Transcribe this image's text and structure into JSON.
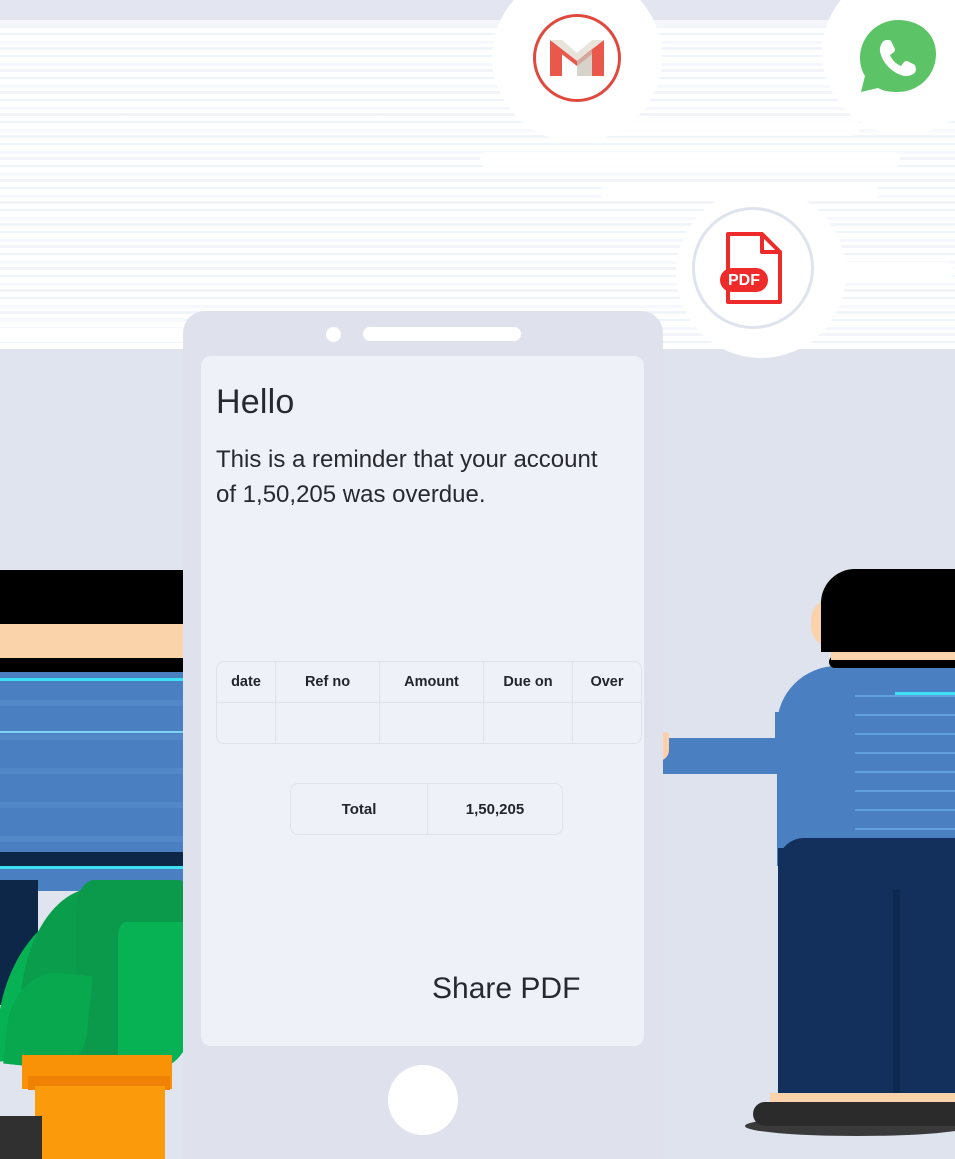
{
  "scene": {
    "title": "Overdue payment reminder on tablet",
    "colors": {
      "background": "#ffffff",
      "wall": "#e0e4ef",
      "panel": "#dfe3ee",
      "tablet_bezel": "#dfe2ec",
      "screen": "#eef1f7",
      "text": "#26292e",
      "shirt_blue": "#4a7fc1",
      "pants_navy": "#13305c",
      "skin": "#fbd3ab",
      "hair": "#000000",
      "plant_green": "#07b254",
      "pot_orange": "#fb9a0b",
      "gmail_red": "#e04a3e",
      "whatsapp_green": "#5cc466",
      "pdf_red": "#ef2a2a"
    }
  },
  "icons": {
    "gmail": {
      "name": "gmail-icon",
      "label": "Gmail",
      "accent": "#e04a3e"
    },
    "whatsapp": {
      "name": "whatsapp-icon",
      "label": "WhatsApp",
      "accent": "#5cc466"
    },
    "pdf": {
      "name": "pdf-file-icon",
      "label": "PDF",
      "badge_text": "PDF",
      "accent": "#ef2a2a"
    }
  },
  "tablet": {
    "camera": "front-camera",
    "speaker": "earpiece-speaker",
    "home_button": "home-button"
  },
  "message": {
    "greeting": "Hello",
    "body": "This is a reminder that your account of 1,50,205 was overdue."
  },
  "invoice_table": {
    "headers": [
      "date",
      "Ref no",
      "Amount",
      "Due on",
      "Over"
    ],
    "rows": [
      [
        "",
        "",
        "",
        "",
        ""
      ]
    ]
  },
  "total_row": {
    "label": "Total",
    "value": "1,50,205"
  },
  "actions": {
    "share_pdf": "Share PDF"
  }
}
